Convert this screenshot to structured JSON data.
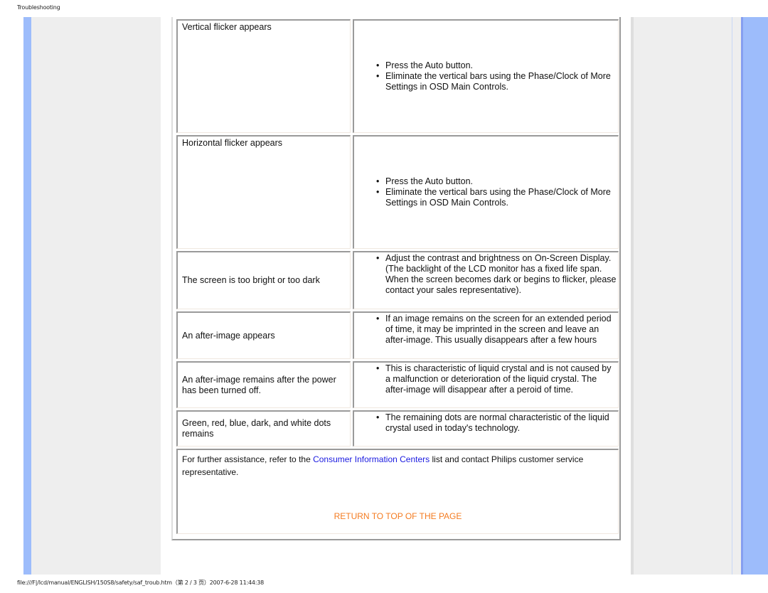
{
  "header": {
    "title": "Troubleshooting"
  },
  "rows": [
    {
      "problem": "Vertical flicker appears",
      "solutions": [
        "Press the Auto button.",
        "Eliminate the vertical bars using the Phase/Clock of More Settings in OSD Main Controls."
      ]
    },
    {
      "problem": "Horizontal flicker appears",
      "solutions": [
        "Press the Auto button.",
        "Eliminate the vertical bars using the Phase/Clock of More Settings in OSD Main Controls."
      ]
    },
    {
      "problem": "The screen is too bright or too dark",
      "solutions": [
        "Adjust the contrast and brightness on On-Screen Display. (The backlight of the LCD monitor has a fixed life span. When the screen becomes dark or begins to flicker, please contact your sales representative)."
      ]
    },
    {
      "problem": "An after-image appears",
      "solutions": [
        "If an image remains on the screen for an extended period of time, it may be imprinted in the screen and leave an after-image. This usually disappears after a few hours"
      ]
    },
    {
      "problem": "An after-image remains after the power has been turned off.",
      "solutions": [
        "This is characteristic of liquid crystal and is not caused by a malfunction or deterioration of the liquid crystal. The after-image will disappear after a peroid of time."
      ]
    },
    {
      "problem": "Green, red, blue, dark, and white dots remains",
      "solutions": [
        "The remaining dots are normal characteristic of the liquid crystal used in today's technology."
      ]
    }
  ],
  "assistance": {
    "prefix": "For further assistance, refer to the ",
    "link_text": "Consumer Information Centers",
    "suffix": " list and contact Philips customer service representative."
  },
  "return_link": "RETURN TO TOP OF THE PAGE",
  "footer": {
    "text": "file:///F|/lcd/manual/ENGLISH/150S8/safety/saf_troub.htm（第 2 / 3 页）2007-6-28 11:44:38"
  },
  "colors": {
    "side_blue": "#9dbcfb",
    "side_gray": "#eeeeee",
    "link_blue": "#1a1ae0",
    "return_orange": "#f47b20"
  }
}
